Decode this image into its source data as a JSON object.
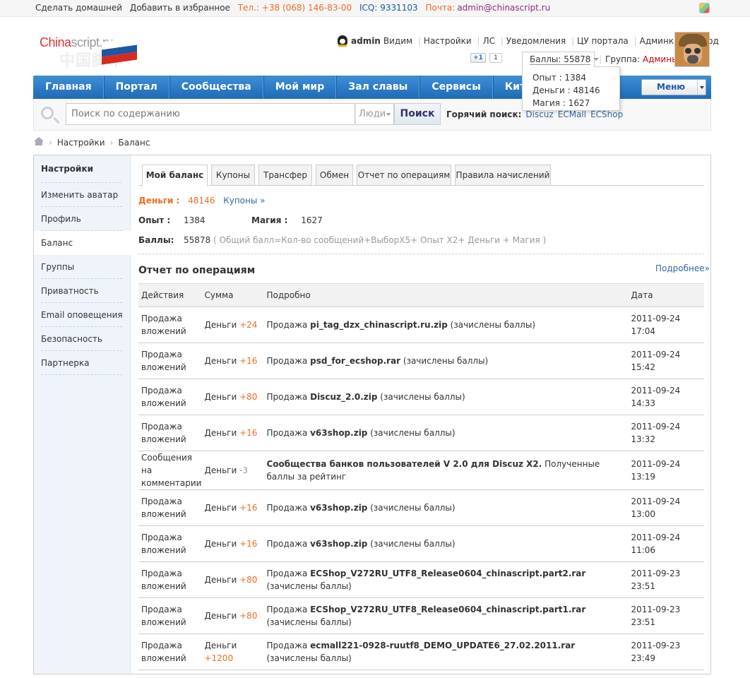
{
  "topbar": {
    "make_home": "Сделать домашней",
    "add_fav": "Добавить в избранное",
    "tel": "Тел.: +38 (068) 146-83-00",
    "icq": "ICQ: 9331103",
    "mail_label": "Почта:",
    "mail": "admin@chinascript.ru",
    "theme_icon": "palette-icon"
  },
  "logo": {
    "brand_a": "China",
    "brand_b": "script.ru",
    "chinese": "中国脚本",
    "flag_colors": [
      "#ffffff",
      "#1c57a5",
      "#d52b1e"
    ]
  },
  "user": {
    "name": "admin",
    "status": "Видим",
    "links": [
      "Настройки",
      "ЛС",
      "Уведомления",
      "ЦУ портала",
      "Админка",
      "Выход"
    ],
    "gplus": "+1",
    "gplus_count": "1",
    "points": "Баллы: 55878",
    "group_label": "Группа:",
    "group_value": "Админы"
  },
  "points_popup": {
    "lines": [
      "Опыт : 1384",
      "Деньги : 48146",
      "Магия : 1627"
    ]
  },
  "nav": {
    "items": [
      "Главная",
      "Портал",
      "Сообщества",
      "Мой мир",
      "Зал славы",
      "Сервисы",
      "Китайские"
    ],
    "menu": "Меню"
  },
  "search": {
    "placeholder": "Поиск по содержанию",
    "type": "Люди",
    "button": "Поиск",
    "hot_label": "Горячий поиск:",
    "hot_links": [
      "Discuz",
      "ECMall",
      "ECShop"
    ]
  },
  "breadcrumb": [
    "Настройки",
    "Баланс"
  ],
  "sidebar": {
    "title": "Настройки",
    "items": [
      "Изменить аватар",
      "Профиль",
      "Баланс",
      "Группы",
      "Приватность",
      "Email оповещения",
      "Безопасность",
      "Партнерка"
    ],
    "active_index": 2
  },
  "tabs": [
    "Мой баланс",
    "Купоны",
    "Трансфер",
    "Обмен",
    "Отчет по операциям",
    "Правила начислений"
  ],
  "balance": {
    "money_label": "Деньги :",
    "money_value": "48146",
    "coupons_link": "Купоны »",
    "exp_label": "Опыт :",
    "exp_value": "1384",
    "magic_label": "Магия :",
    "magic_value": "1627",
    "points_label": "Баллы:",
    "points_value": "55878",
    "formula": "( Общий балл=Кол-во сообщений+ВыборX5+ Опыт X2+ Деньги + Магия )"
  },
  "report": {
    "title": "Отчет по операциям",
    "more": "Подробнее»",
    "headers": [
      "Действия",
      "Сумма",
      "Подробно",
      "Дата"
    ],
    "rows": [
      {
        "action": [
          "Продажа",
          "вложений"
        ],
        "cur": "Деньги",
        "amt": "+24",
        "pre": "Продажа ",
        "file": "pi_tag_dzx_chinascript.ru.zip",
        "post": " (зачислены баллы)",
        "date": "2011-09-24 17:04"
      },
      {
        "action": [
          "Продажа",
          "вложений"
        ],
        "cur": "Деньги",
        "amt": "+16",
        "pre": "Продажа ",
        "file": "psd_for_ecshop.rar",
        "post": " (зачислены баллы)",
        "date": "2011-09-24 15:42"
      },
      {
        "action": [
          "Продажа",
          "вложений"
        ],
        "cur": "Деньги",
        "amt": "+80",
        "pre": "Продажа ",
        "file": "Discuz_2.0.zip",
        "post": " (зачислены баллы)",
        "date": "2011-09-24 14:33"
      },
      {
        "action": [
          "Продажа",
          "вложений"
        ],
        "cur": "Деньги",
        "amt": "+16",
        "pre": "Продажа ",
        "file": "v63shop.zip",
        "post": " (зачислены баллы)",
        "date": "2011-09-24 13:32"
      },
      {
        "action": [
          "Сообщения на",
          "комментарии"
        ],
        "cur": "Деньги",
        "amt": "-3",
        "pre": "",
        "file": "Сообщества банков пользователей V 2.0 для Discuz X2.",
        "post": " Полученные баллы за рейтинг",
        "date": "2011-09-24 13:19"
      },
      {
        "action": [
          "Продажа",
          "вложений"
        ],
        "cur": "Деньги",
        "amt": "+16",
        "pre": "Продажа ",
        "file": "v63shop.zip",
        "post": " (зачислены баллы)",
        "date": "2011-09-24 13:00"
      },
      {
        "action": [
          "Продажа",
          "вложений"
        ],
        "cur": "Деньги",
        "amt": "+16",
        "pre": "Продажа ",
        "file": "v63shop.zip",
        "post": " (зачислены баллы)",
        "date": "2011-09-24 11:06"
      },
      {
        "action": [
          "Продажа",
          "вложений"
        ],
        "cur": "Деньги",
        "amt": "+80",
        "pre": "Продажа ",
        "file": "ECShop_V272RU_UTF8_Release0604_chinascript.part2.rar",
        "post": " (зачислены баллы)",
        "date": "2011-09-23 23:51"
      },
      {
        "action": [
          "Продажа",
          "вложений"
        ],
        "cur": "Деньги",
        "amt": "+80",
        "pre": "Продажа ",
        "file": "ECShop_V272RU_UTF8_Release0604_chinascript.part1.rar",
        "post": " (зачислены баллы)",
        "date": "2011-09-23 23:51"
      },
      {
        "action": [
          "Продажа",
          "вложений"
        ],
        "cur": "Деньги",
        "amt": "+1200",
        "pre": "Продажа ",
        "file": "ecmall221-0928-ruutf8_DEMO_UPDATE6_27.02.2011.rar",
        "post": " (зачислены баллы)",
        "date": "2011-09-23 23:49"
      }
    ]
  },
  "colors": {
    "nav_blue": "#1f6ab6",
    "accent_orange": "#f26c22",
    "link_blue": "#3366aa",
    "group_red": "#cc0000"
  }
}
